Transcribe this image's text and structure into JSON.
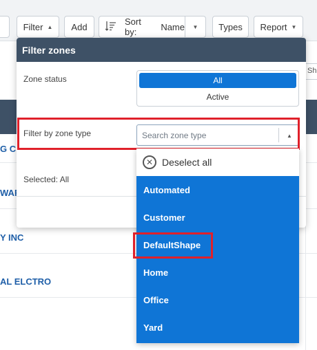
{
  "toolbar": {
    "filter_label": "Filter",
    "add_label": "Add",
    "sort_label": "Sort by:",
    "sort_value": "Name",
    "types_label": "Types",
    "report_label": "Report"
  },
  "background": {
    "companies": [
      "G C",
      "WAR",
      "Y INC",
      "AL ELCTRO"
    ],
    "right_edge_text": "Sho"
  },
  "panel": {
    "title": "Filter zones",
    "zone_status_label": "Zone status",
    "status_options": [
      "All",
      "Active"
    ],
    "selected_status": "All",
    "zone_type_label": "Filter by zone type",
    "search_placeholder": "Search zone type",
    "selected_text": "Selected: All"
  },
  "dropdown": {
    "deselect_label": "Deselect all",
    "items": [
      "Automated",
      "Customer",
      "DefaultShape",
      "Home",
      "Office",
      "Yard"
    ]
  },
  "colors": {
    "header": "#3e5166",
    "accent": "#0f75d6",
    "highlight": "#e0202a",
    "company_text": "#1f5fa8"
  },
  "icons": {
    "sort": "sort-lines-icon",
    "caret": "caret-icon",
    "deselect": "x-circle-icon"
  }
}
